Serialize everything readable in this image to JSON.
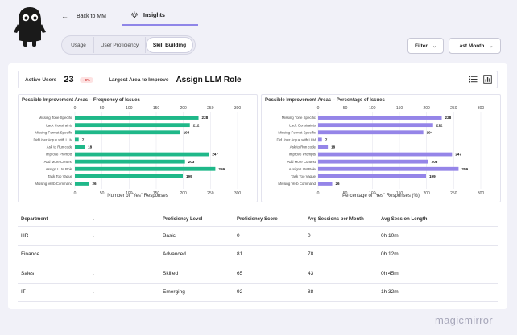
{
  "nav": {
    "back_label": "Back to MM",
    "insights_label": "Insights"
  },
  "tabs": [
    "Usage",
    "User Proficiency",
    "Skill Building"
  ],
  "active_tab": "Skill Building",
  "filter_label": "Filter",
  "month_label": "Last Month",
  "stats": {
    "active_users_label": "Active Users",
    "active_users_value": "23",
    "active_users_change": "- 8%",
    "area_label": "Largest Area to Improve",
    "area_value": "Assign LLM Role"
  },
  "chart_data": [
    {
      "type": "bar",
      "orientation": "horizontal",
      "title": "Possible Improvement Areas – Frequency of Issues",
      "xlabel": "Number of \"Yes\" Responses",
      "categories": [
        "Missing Tone Specific",
        "Lack Constraints",
        "Missing Format Specific",
        "Did User Argue with LLM",
        "Ask to Run code",
        "Improve Prompts",
        "Add More Context",
        "Assign LLM Role",
        "Task Too Vague",
        "Missing Verb Command"
      ],
      "values": [
        228,
        212,
        194,
        7,
        18,
        247,
        203,
        259,
        199,
        26
      ],
      "xticks": [
        0,
        50,
        100,
        150,
        200,
        250,
        300
      ],
      "xlim": [
        0,
        300
      ],
      "color": "#1fb889"
    },
    {
      "type": "bar",
      "orientation": "horizontal",
      "title": "Possible Improvement Areas – Percentage of Issues",
      "xlabel": "Percentage of \"Yes\" Responses (%)",
      "categories": [
        "Missing Tone Specific",
        "Lack Constraints",
        "Missing Format Specific",
        "Did User Argue with LLM",
        "Ask to Run code",
        "Improve Prompts",
        "Add More Context",
        "Assign LLM Role",
        "Task Too Vague",
        "Missing Verb Command"
      ],
      "values": [
        228,
        212,
        194,
        7,
        18,
        247,
        203,
        259,
        199,
        26
      ],
      "xticks": [
        0,
        50,
        100,
        150,
        200,
        250,
        300
      ],
      "xlim": [
        0,
        300
      ],
      "color": "#9585e8"
    }
  ],
  "table": {
    "headers": [
      "Department",
      ".",
      "Proficiency Level",
      "Proficiency Score",
      "Avg Sessions per Month",
      "Avg Session Length"
    ],
    "rows": [
      [
        "HR",
        ".",
        "Basic",
        "0",
        "0",
        "0h 10m"
      ],
      [
        "Finance",
        ".",
        "Advanced",
        "81",
        "78",
        "0h 12m"
      ],
      [
        "Sales",
        ".",
        "Skilled",
        "65",
        "43",
        "0h 45m"
      ],
      [
        "IT",
        ".",
        "Emerging",
        "92",
        "88",
        "1h 32m"
      ]
    ]
  },
  "brand": "magicmirror"
}
